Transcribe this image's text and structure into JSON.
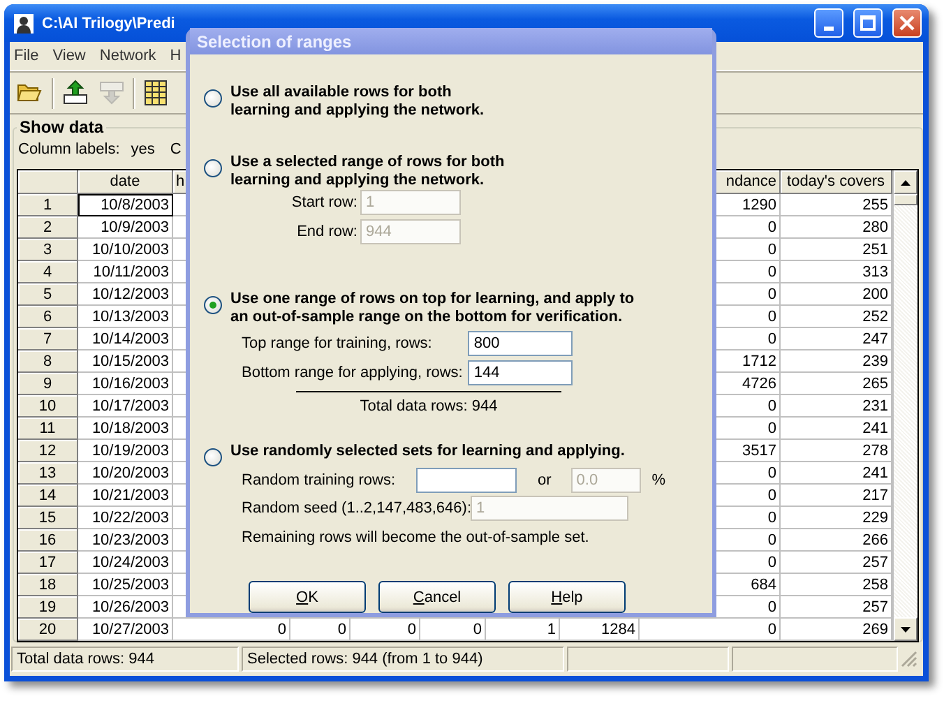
{
  "window": {
    "title": "C:\\AI Trilogy\\Predi"
  },
  "menu": [
    {
      "label": "File"
    },
    {
      "label": "View"
    },
    {
      "label": "Network"
    },
    {
      "label": "H"
    }
  ],
  "toolbar": [
    {
      "kind": "open",
      "disabled": false
    },
    {
      "kind": "export",
      "disabled": false
    },
    {
      "kind": "import",
      "disabled": true
    },
    {
      "kind": "grid",
      "disabled": false
    }
  ],
  "panel": {
    "title": "Show data",
    "column_labels": "Column labels:",
    "column_labels_value": "yes",
    "cut_label": "C"
  },
  "table": {
    "columns": [
      {
        "label": "date"
      },
      {
        "label": "h"
      },
      {},
      {},
      {},
      {},
      {},
      {
        "label": "ndance"
      },
      {
        "label": "today's covers"
      }
    ],
    "rows": [
      {
        "num": "1",
        "date": "10/8/2003",
        "column_9": "1290",
        "covers": "255",
        "focused": true
      },
      {
        "num": "2",
        "date": "10/9/2003",
        "column_9": "0",
        "covers": "280",
        "focused": false
      },
      {
        "num": "3",
        "date": "10/10/2003",
        "column_9": "0",
        "covers": "251",
        "focused": false
      },
      {
        "num": "4",
        "date": "10/11/2003",
        "column_9": "0",
        "covers": "313",
        "focused": false
      },
      {
        "num": "5",
        "date": "10/12/2003",
        "column_9": "0",
        "covers": "200",
        "focused": false
      },
      {
        "num": "6",
        "date": "10/13/2003",
        "column_9": "0",
        "covers": "252",
        "focused": false
      },
      {
        "num": "7",
        "date": "10/14/2003",
        "column_9": "0",
        "covers": "247",
        "focused": false
      },
      {
        "num": "8",
        "date": "10/15/2003",
        "column_9": "1712",
        "covers": "239",
        "focused": false
      },
      {
        "num": "9",
        "date": "10/16/2003",
        "column_9": "4726",
        "covers": "265",
        "focused": false
      },
      {
        "num": "10",
        "date": "10/17/2003",
        "column_9": "0",
        "covers": "231",
        "focused": false
      },
      {
        "num": "11",
        "date": "10/18/2003",
        "column_9": "0",
        "covers": "241",
        "focused": false
      },
      {
        "num": "12",
        "date": "10/19/2003",
        "column_9": "3517",
        "covers": "278",
        "focused": false
      },
      {
        "num": "13",
        "date": "10/20/2003",
        "column_9": "0",
        "covers": "241",
        "focused": false
      },
      {
        "num": "14",
        "date": "10/21/2003",
        "column_9": "0",
        "covers": "217",
        "focused": false
      },
      {
        "num": "15",
        "date": "10/22/2003",
        "column_9": "0",
        "covers": "229",
        "focused": false
      },
      {
        "num": "16",
        "date": "10/23/2003",
        "column_9": "0",
        "covers": "266",
        "focused": false
      },
      {
        "num": "17",
        "date": "10/24/2003",
        "column_9": "0",
        "covers": "257",
        "focused": false
      },
      {
        "num": "18",
        "date": "10/25/2003",
        "column_9": "684",
        "covers": "258",
        "focused": false
      },
      {
        "num": "19",
        "date": "10/26/2003",
        "column_9": "0",
        "covers": "257",
        "focused": false
      },
      {
        "num": "20",
        "date": "10/27/2003",
        "middle": [
          "0",
          "0",
          "0",
          "0",
          "1",
          "1284"
        ],
        "column_9": "0",
        "covers": "269",
        "focused": false
      }
    ]
  },
  "status_bar": [
    "Total data rows: 944",
    "Selected rows: 944  (from 1 to 944)"
  ],
  "dialog": {
    "title": "Selection of ranges",
    "options": [
      {
        "kind": "all",
        "selected": false,
        "label": "Use all available rows for both\nlearning and applying the network."
      },
      {
        "kind": "range",
        "selected": false,
        "label": "Use a selected range of rows for both\nlearning and applying the network.",
        "fields": [
          {
            "label": "Start row:",
            "value": "1",
            "disabled": true
          },
          {
            "label": "End row:",
            "value": "944",
            "disabled": true
          }
        ]
      },
      {
        "kind": "split",
        "selected": true,
        "label": "Use one range of rows on top for learning, and apply to\nan out-of-sample range on the bottom for verification.",
        "fields": [
          {
            "label": "Top range for training, rows:",
            "value": "800",
            "disabled": false
          },
          {
            "label": "Bottom range for applying, rows:",
            "value": "144",
            "disabled": false
          }
        ],
        "total": "Total data rows:  944"
      },
      {
        "kind": "random",
        "selected": false,
        "label": "Use randomly selected sets for learning and applying.",
        "training": {
          "label": "Random training rows:",
          "disabled": false,
          "or": "or",
          "percent_value": "0.0",
          "percent_disabled": true,
          "unit": "%"
        },
        "seed": {
          "label": "Random seed (1..2,147,483,646):",
          "value": "1",
          "disabled": true
        },
        "note": "Remaining rows will become the out-of-sample set."
      }
    ],
    "buttons": [
      {
        "label": "OK",
        "underline_first": true
      },
      {
        "label": "Cancel",
        "underline_first": true
      },
      {
        "label": "Help",
        "underline_first": true
      }
    ]
  }
}
